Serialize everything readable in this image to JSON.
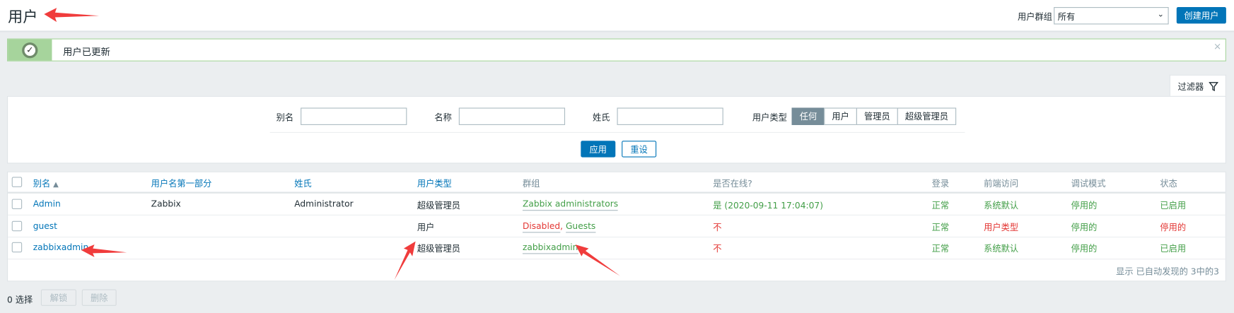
{
  "header": {
    "title": "用户",
    "group_label": "用户群组",
    "group_value": "所有",
    "create_button": "创建用户"
  },
  "message": {
    "text": "用户已更新",
    "close": "×"
  },
  "filter": {
    "tab_label": "过滤器",
    "alias_label": "别名",
    "alias_value": "",
    "name_label": "名称",
    "name_value": "",
    "surname_label": "姓氏",
    "surname_value": "",
    "type_label": "用户类型",
    "types": [
      "任何",
      "用户",
      "管理员",
      "超级管理员"
    ],
    "selected_type": "任何",
    "apply": "应用",
    "reset": "重设"
  },
  "table": {
    "columns": [
      "别名",
      "用户名第一部分",
      "姓氏",
      "用户类型",
      "群组",
      "是否在线?",
      "登录",
      "前端访问",
      "调试模式",
      "状态"
    ],
    "sort_indicator": "▲",
    "rows": [
      {
        "alias": "Admin",
        "name": "Zabbix",
        "surname": "Administrator",
        "type": "超级管理员",
        "groups": [
          {
            "text": "Zabbix administrators",
            "color": "green"
          }
        ],
        "online": "是 (2020-09-11 17:04:07)",
        "login": "正常",
        "frontend": "系统默认",
        "debug": "停用的",
        "status": "已启用"
      },
      {
        "alias": "guest",
        "name": "",
        "surname": "",
        "type": "用户",
        "groups": [
          {
            "text": "Disabled",
            "color": "red"
          },
          {
            "text": "Guests",
            "color": "green"
          }
        ],
        "online": "不",
        "login": "正常",
        "frontend": "用户类型",
        "debug": "停用的",
        "status": "停用的"
      },
      {
        "alias": "zabbixadmin",
        "name": "",
        "surname": "",
        "type": "超级管理员",
        "groups": [
          {
            "text": "zabbixadmin",
            "color": "green"
          }
        ],
        "online": "不",
        "login": "正常",
        "frontend": "系统默认",
        "debug": "停用的",
        "status": "已启用"
      }
    ],
    "footer": "显示 已自动发现的 3中的3"
  },
  "bottom": {
    "selected": "0 选择",
    "unlock": "解锁",
    "delete": "删除",
    "group_separator": ", "
  },
  "colors": {
    "accent": "#0275b8",
    "green": "#429e47",
    "red": "#e33734",
    "annotation": "#f03c3c"
  }
}
